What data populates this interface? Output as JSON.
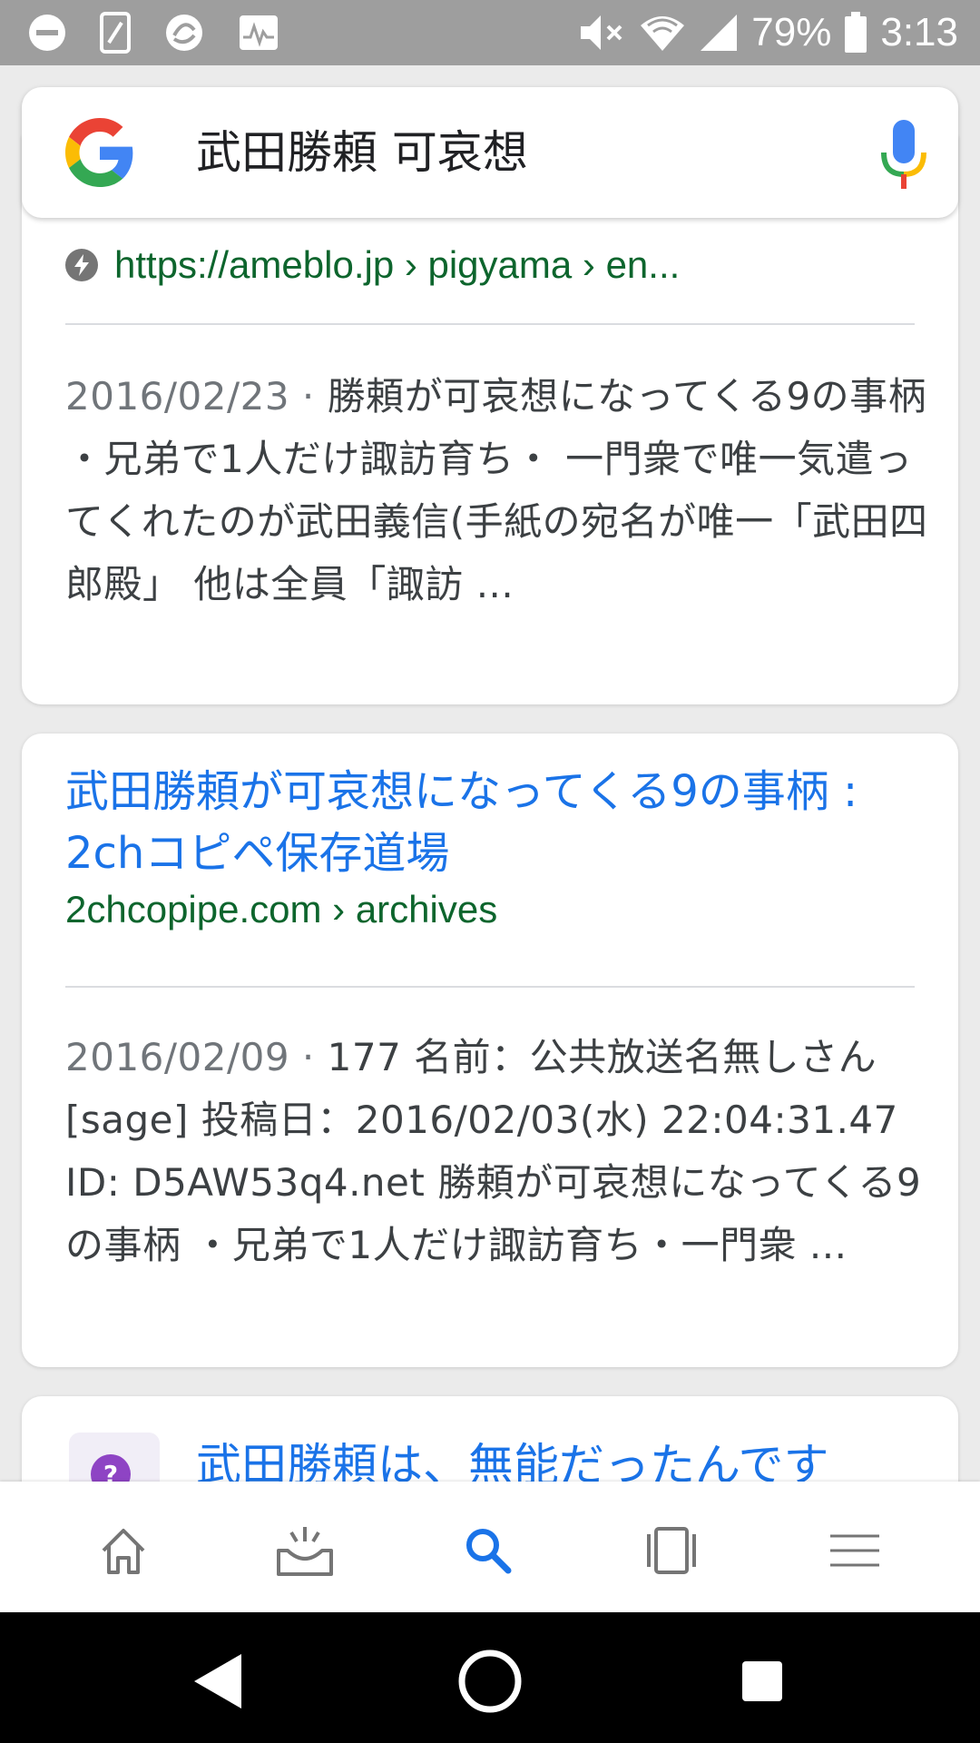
{
  "status_bar": {
    "battery_percent": "79%",
    "time": "3:13",
    "icons": [
      "minus-circle-icon",
      "screen-icon",
      "sync-icon",
      "activity-icon",
      "mute-icon",
      "wifi-icon",
      "signal-icon",
      "battery-icon"
    ]
  },
  "search": {
    "query": "武田勝頼 可哀想",
    "logo": "google-g-logo",
    "mic": "mic-icon"
  },
  "results": [
    {
      "url": "https://ameblo.jp › pigyama › en...",
      "date": "2016/02/23",
      "separator": " · ",
      "snippet": "勝頼が可哀想になってくる9の事柄 ・兄弟で1人だけ諏訪育ち・ 一門衆で唯一気遣ってくれたのが武田義信(手紙の宛名が唯一「武田四郎殿」 他は全員「諏訪 ..."
    },
    {
      "title": "武田勝頼が可哀想になってくる9の事柄 : 2chコピペ保存道場",
      "url": "2chcopipe.com › archives",
      "date": "2016/02/09",
      "separator": " · ",
      "snippet": "177 名前：公共放送名無しさん[sage] 投稿日：2016/02/03(水) 22:04:31.47 ID: D5AW53q4.net 勝頼が可哀想になってくる9の事柄 ・兄弟で1人だけ諏訪育ち・一門衆 ..."
    },
    {
      "title": "武田勝頼は、無能だったんです"
    }
  ],
  "app_nav": [
    "home-icon",
    "updates-icon",
    "search-icon",
    "tabs-icon",
    "menu-icon"
  ],
  "system_nav": [
    "back-button",
    "home-button",
    "recents-button"
  ],
  "colors": {
    "link_blue": "#1a73e8",
    "url_green": "#0d652d",
    "status_bar": "#9e9e9e",
    "active_nav": "#1a73e8"
  }
}
